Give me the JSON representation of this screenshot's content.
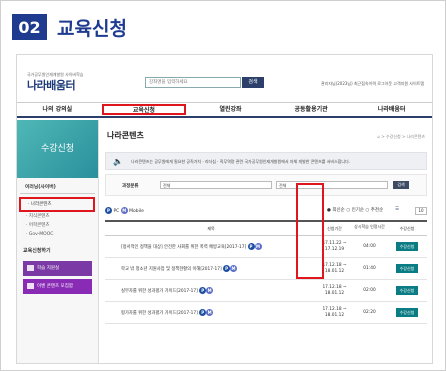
{
  "header": {
    "number": "02",
    "title": "교육신청"
  },
  "site": {
    "logo": "나라배움터",
    "logo_sub": "국가공무원인재개발원 사이버학습",
    "search_placeholder": "강좌명을 입력하세요",
    "search_button": "검색",
    "util_text": "관리자님(2023님) 최근접속이력 로그아웃 고객지원 사이트맵"
  },
  "nav": [
    "나의 강의실",
    "교육신청",
    "열린강좌",
    "공동활용기관",
    "나라배움터"
  ],
  "sidebar": {
    "banner": "수강신청",
    "section1": "이러닝(사이버)",
    "sub_items": [
      "나라콘텐츠",
      "지식콘텐츠",
      "어학콘텐츠",
      "Gov-MOOC"
    ],
    "section2": "교육신청하기",
    "buttons": [
      "학습 지원실",
      "이벤 콘텐츠 모집함"
    ]
  },
  "main": {
    "title": "나라콘텐츠",
    "breadcrumb": "⌂ > 수강신청 > 나라콘텐츠",
    "notice": "나라콘텐츠는 공무원에게 필요한 공직가치 · 리더십 · 직무역량 관련 국가공무원인재개발원에서 자체 개발한 콘텐츠를 서비스합니다.",
    "filter_label": "과정분류",
    "select1": "전체",
    "select2": "전체",
    "filter_button": "검색",
    "device_pc": "PC",
    "device_mobile": "Mobile",
    "sort_options": [
      "최신순",
      "인기순",
      "추천순"
    ],
    "per_page": "10",
    "col_headers": [
      "제목",
      "신청기간",
      "상시학습 인정시간",
      "수강신청"
    ],
    "rows": [
      {
        "title": "[정서적인 정책을 대상] 안전한 사회를 위한 폭력 예방교육[2017-17]",
        "period": "17.11.22 ~ 17.12.19",
        "hours": "04:00",
        "btn": "수강신청"
      },
      {
        "title": "학교 밖 청소년 지원사업 및 정책현황의 이해[2017-17]",
        "period": "17.12.18 ~ 18.01.12",
        "hours": "01:40",
        "btn": "수강신청"
      },
      {
        "title": "실무자를 위한 성과평가 가이드[2017-17]",
        "period": "17.12.18 ~ 18.01.12",
        "hours": "02:00",
        "btn": "수강신청"
      },
      {
        "title": "평가자를 위한 성과평가 가이드[2017-17]",
        "period": "17.12.18 ~ 18.01.12",
        "hours": "02:20",
        "btn": "수강신청"
      }
    ]
  },
  "colors": {
    "primary": "#1f3b8f",
    "highlight": "#e0161e",
    "teal": "#0a7c84",
    "purple": "#7b39a5"
  }
}
